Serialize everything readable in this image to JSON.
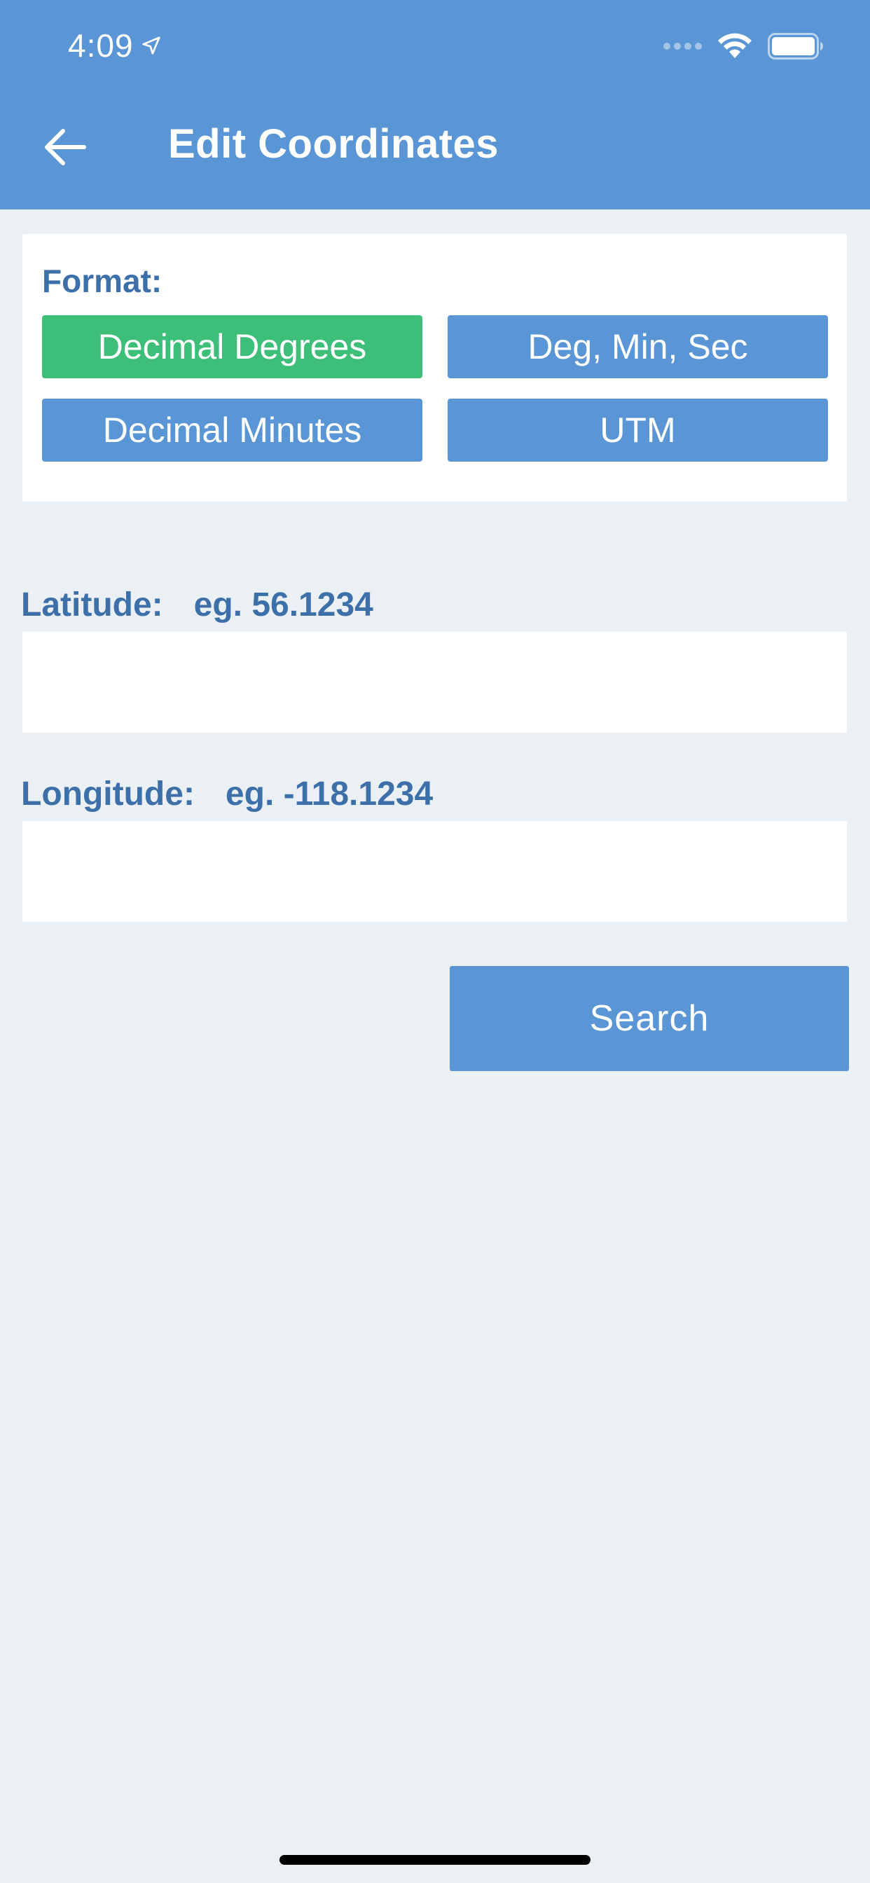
{
  "status_bar": {
    "time": "4:09",
    "location_icon": "location-arrow-icon",
    "wifi_icon": "wifi-icon",
    "battery_icon": "battery-icon"
  },
  "header": {
    "title": "Edit Coordinates",
    "back_icon": "arrow-left-icon",
    "background": "#5A95D5"
  },
  "format": {
    "label": "Format:",
    "options": [
      {
        "label": "Decimal Degrees",
        "selected": true
      },
      {
        "label": "Deg, Min, Sec",
        "selected": false
      },
      {
        "label": "Decimal Minutes",
        "selected": false
      },
      {
        "label": "UTM",
        "selected": false
      }
    ],
    "selected_color": "#3DBF7A",
    "unselected_color": "#5A95D5"
  },
  "latitude": {
    "label": "Latitude:",
    "hint": "eg. 56.1234",
    "value": ""
  },
  "longitude": {
    "label": "Longitude:",
    "hint": "eg. -118.1234",
    "value": ""
  },
  "search": {
    "label": "Search"
  },
  "colors": {
    "background": "#EBF0F5",
    "label_text": "#3D6FA8"
  }
}
